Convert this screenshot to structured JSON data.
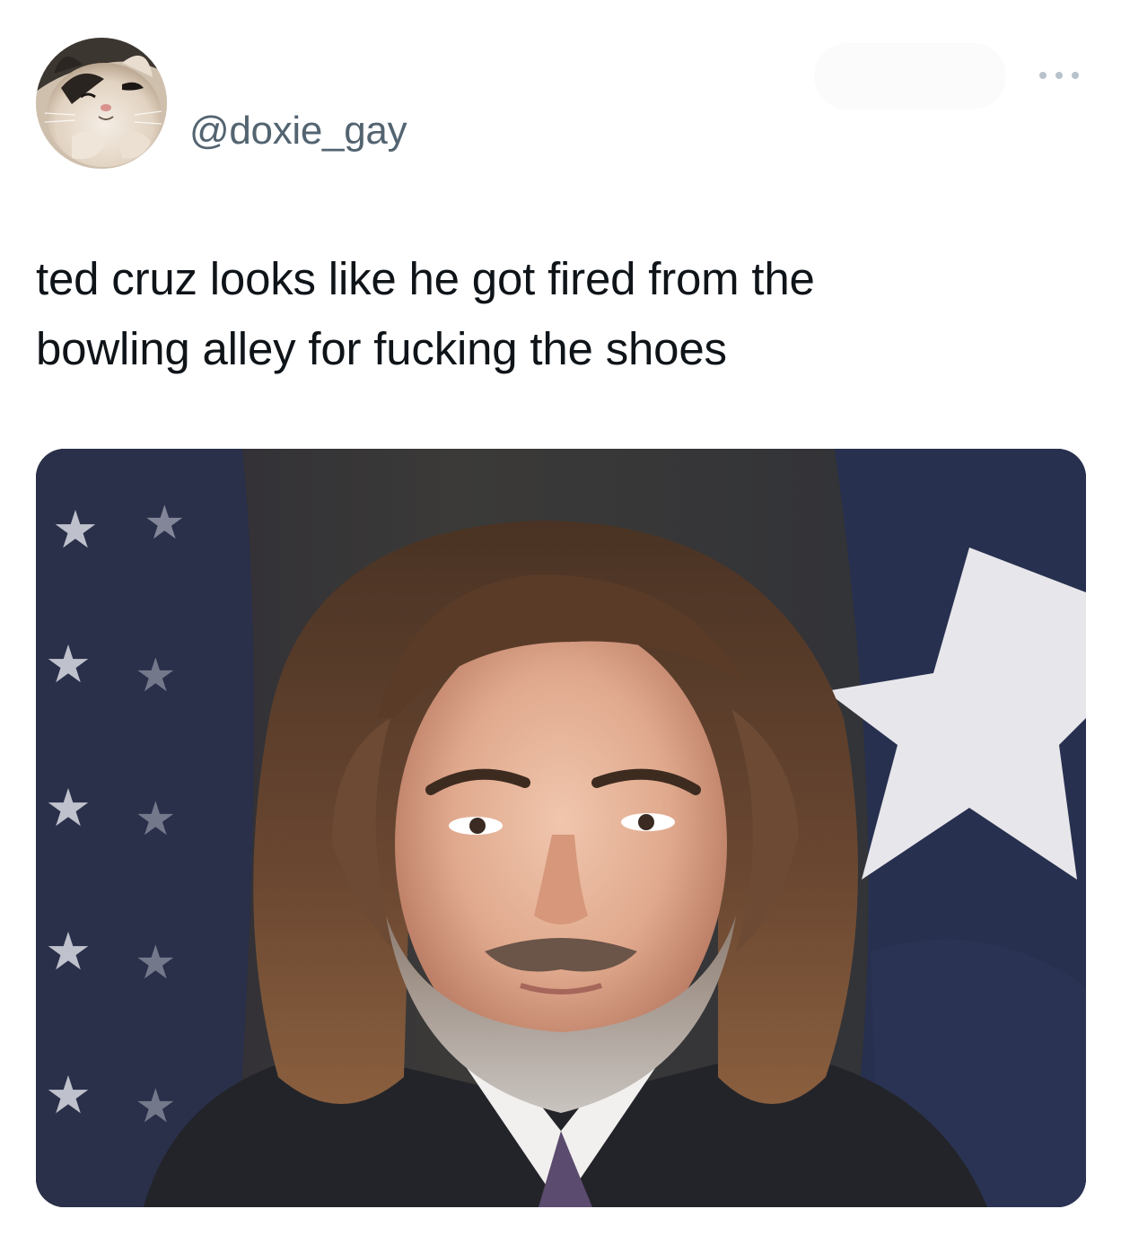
{
  "tweet": {
    "handle": "@doxie_gay",
    "text_line_1": "ted cruz looks like he got fired from the",
    "text_line_2": "bowling alley for fucking the shoes"
  },
  "icons": {
    "more": "more-horizontal-icon",
    "avatar": "cat-avatar"
  },
  "colors": {
    "handle": "#536471",
    "text": "#0f1419",
    "background": "#ffffff"
  }
}
